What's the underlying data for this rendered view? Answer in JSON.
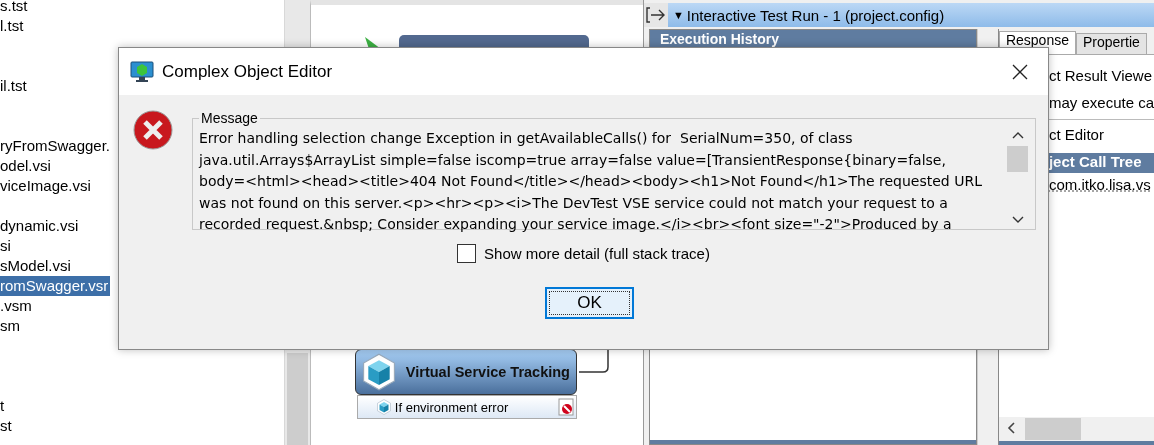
{
  "file_list": {
    "items": [
      {
        "label": "s.tst",
        "selected": false
      },
      {
        "label": "l.tst",
        "selected": false
      },
      {
        "label": "il.tst",
        "selected": false
      },
      {
        "label": "ryFromSwagger.",
        "selected": false
      },
      {
        "label": "odel.vsi",
        "selected": false
      },
      {
        "label": "viceImage.vsi",
        "selected": false
      },
      {
        "label": "dynamic.vsi",
        "selected": false
      },
      {
        "label": "si",
        "selected": false
      },
      {
        "label": "sModel.vsi",
        "selected": false
      },
      {
        "label": "romSwagger.vsr",
        "selected": true
      },
      {
        "label": ".vsm",
        "selected": false
      },
      {
        "label": "sm",
        "selected": false
      },
      {
        "label": "t",
        "selected": false
      },
      {
        "label": "st",
        "selected": false
      }
    ]
  },
  "canvas": {
    "node": {
      "label": "Virtual Service Tracking",
      "branch": "If environment error"
    }
  },
  "test_run_panel": {
    "expand_glyph": "▼",
    "title": "Interactive Test Run - 1 (project.config)",
    "execution_history": "Execution History",
    "tabs": [
      {
        "label": "Response",
        "selected": true
      },
      {
        "label": "Propertie",
        "selected": false
      }
    ],
    "result_viewer": "ct Result Viewe",
    "hint": "may execute ca",
    "editor_legend": "ct Editor",
    "call_tree_header": "ject Call Tree",
    "call_tree_item": "com.itko.lisa.vs"
  },
  "dialog": {
    "title": "Complex Object Editor",
    "message_legend": "Message",
    "message_lines": [
      "Error handling selection change Exception in getAvailableCalls() for  SerialNum=350, of class",
      "java.util.Arrays$ArrayList simple=false iscomp=true array=false value=[TransientResponse{binary=false,",
      "body=<html><head><title>404 Not Found</title></head><body><h1>Not Found</h1>The requested URL",
      "was not found on this server.<p><hr><p><i>The DevTest VSE service could not match your request to a",
      "recorded request.&nbsp; Consider expanding your service image.</i><br><font size=\"-2\">Produced by a"
    ],
    "show_detail": {
      "label": "Show more detail (full stack trace)",
      "checked": false
    },
    "ok_button": "OK"
  }
}
